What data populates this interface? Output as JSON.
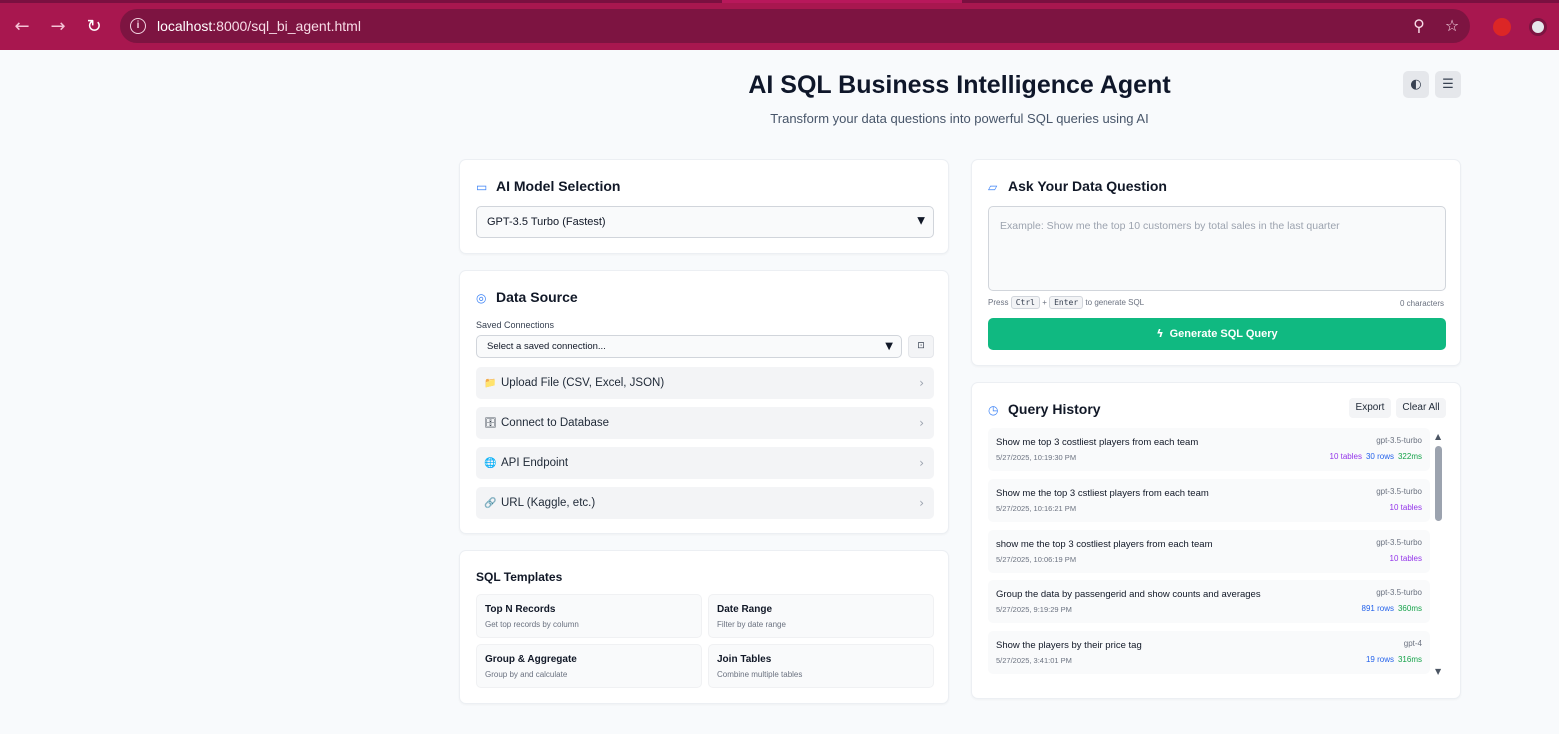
{
  "browser": {
    "url_host": "localhost",
    "url_path": ":8000/sql_bi_agent.html"
  },
  "header": {
    "title": "AI SQL Business Intelligence Agent",
    "subtitle": "Transform your data questions into powerful SQL queries using AI"
  },
  "model_selection": {
    "title": "AI Model Selection",
    "selected": "GPT-3.5 Turbo (Fastest)"
  },
  "data_source": {
    "title": "Data Source",
    "saved_label": "Saved Connections",
    "saved_selected": "Select a saved connection...",
    "options": [
      {
        "icon": "📁",
        "label": "Upload File (CSV, Excel, JSON)"
      },
      {
        "icon": "🗄",
        "label": "Connect to Database"
      },
      {
        "icon": "🌐",
        "label": "API Endpoint"
      },
      {
        "icon": "🔗",
        "label": "URL (Kaggle, etc.)"
      }
    ]
  },
  "templates": {
    "title": "SQL Templates",
    "items": [
      {
        "name": "Top N Records",
        "desc": "Get top records by column"
      },
      {
        "name": "Date Range",
        "desc": "Filter by date range"
      },
      {
        "name": "Group & Aggregate",
        "desc": "Group by and calculate"
      },
      {
        "name": "Join Tables",
        "desc": "Combine multiple tables"
      }
    ]
  },
  "question": {
    "title": "Ask Your Data Question",
    "placeholder": "Example: Show me the top 10 customers by total sales in the last quarter",
    "hint_press": "Press",
    "hint_key1": "Ctrl",
    "hint_plus": "+",
    "hint_key2": "Enter",
    "hint_tail": "to generate SQL",
    "char_count": "0 characters",
    "generate_label": "Generate SQL Query"
  },
  "history": {
    "title": "Query History",
    "export_label": "Export",
    "clear_label": "Clear All",
    "items": [
      {
        "query": "Show me top 3 costliest players from each team",
        "time": "5/27/2025, 10:19:30 PM",
        "model": "gpt-3.5-turbo",
        "tables": "10 tables",
        "rows": "30 rows",
        "ms": "322ms"
      },
      {
        "query": "Show me the top 3 cstliest players from each team",
        "time": "5/27/2025, 10:16:21 PM",
        "model": "gpt-3.5-turbo",
        "tables": "10 tables",
        "rows": "",
        "ms": ""
      },
      {
        "query": "show me the top 3 costliest players from each team",
        "time": "5/27/2025, 10:06:19 PM",
        "model": "gpt-3.5-turbo",
        "tables": "10 tables",
        "rows": "",
        "ms": ""
      },
      {
        "query": "Group the data by passengerid and show counts and averages",
        "time": "5/27/2025, 9:19:29 PM",
        "model": "gpt-3.5-turbo",
        "tables": "",
        "rows": "891 rows",
        "ms": "360ms"
      },
      {
        "query": "Show the players by their price tag",
        "time": "5/27/2025, 3:41:01 PM",
        "model": "gpt-4",
        "tables": "",
        "rows": "19 rows",
        "ms": "316ms"
      }
    ]
  },
  "colors": {
    "browser_frame": "#a8174f",
    "accent_green": "#10b981",
    "accent_blue": "#3b82f6"
  }
}
